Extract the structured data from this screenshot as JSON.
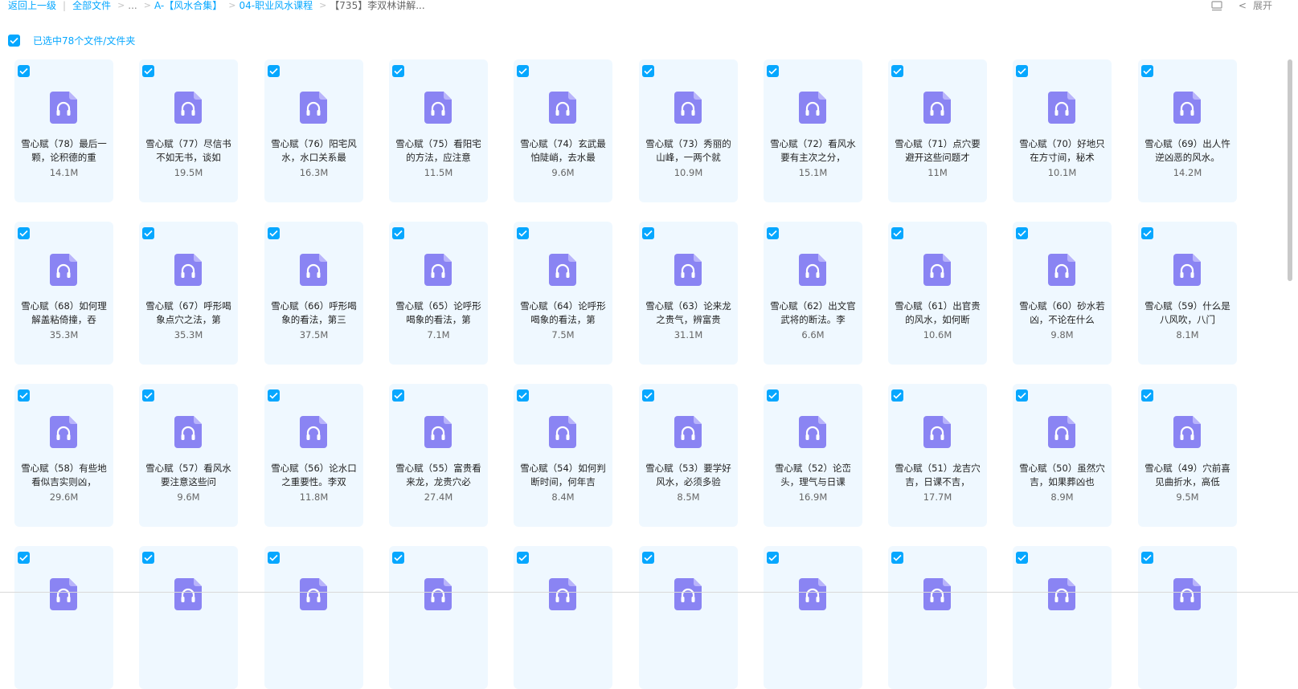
{
  "breadcrumb": {
    "back": "返回上一级",
    "all_files": "全部文件",
    "ellipsis": "...",
    "items": [
      "A-【风水合集】",
      "04-职业风水课程"
    ],
    "current": "【735】李双林讲解..."
  },
  "toolbar": {
    "expand_label": "展开",
    "view_icon": "list-view-icon"
  },
  "selection": {
    "label": "已选中78个文件/文件夹"
  },
  "colors": {
    "accent": "#06a7ff",
    "card_bg": "#eff8ff",
    "icon": "#8a84f3"
  },
  "files": [
    {
      "name": "雪心赋（78）最后一颗，论积德的重",
      "size": "14.1M"
    },
    {
      "name": "雪心赋（77）尽信书不如无书，谈如",
      "size": "19.5M"
    },
    {
      "name": "雪心赋（76）阳宅风水，水口关系最",
      "size": "16.3M"
    },
    {
      "name": "雪心赋（75）看阳宅的方法，应注意",
      "size": "11.5M"
    },
    {
      "name": "雪心赋（74）玄武最怕陡峭，去水最",
      "size": "9.6M"
    },
    {
      "name": "雪心赋（73）秀丽的山峰，一两个就",
      "size": "10.9M"
    },
    {
      "name": "雪心赋（72）看风水要有主次之分，",
      "size": "15.1M"
    },
    {
      "name": "雪心赋（71）点穴要避开这些问题才",
      "size": "11M"
    },
    {
      "name": "雪心赋（70）好地只在方寸间，秘术",
      "size": "10.1M"
    },
    {
      "name": "雪心赋（69）出人忤逆凶恶的风水。",
      "size": "14.2M"
    },
    {
      "name": "雪心赋（68）如何理解盖粘倚撞，吞",
      "size": "35.3M"
    },
    {
      "name": "雪心赋（67）呼形喝象点穴之法，第",
      "size": "35.3M"
    },
    {
      "name": "雪心赋（66）呼形喝象的看法，第三",
      "size": "37.5M"
    },
    {
      "name": "雪心赋（65）论呼形喝象的看法，第",
      "size": "7.1M"
    },
    {
      "name": "雪心赋（64）论呼形喝象的看法，第",
      "size": "7.5M"
    },
    {
      "name": "雪心赋（63）论来龙之贵气，辨富贵",
      "size": "31.1M"
    },
    {
      "name": "雪心赋（62）出文官武将的断法。李",
      "size": "6.6M"
    },
    {
      "name": "雪心赋（61）出官贵的风水，如何断",
      "size": "10.6M"
    },
    {
      "name": "雪心赋（60）砂水若凶，不论在什么",
      "size": "9.8M"
    },
    {
      "name": "雪心赋（59）什么是八风吹，八门",
      "size": "8.1M"
    },
    {
      "name": "雪心赋（58）有些地看似吉实则凶，",
      "size": "29.6M"
    },
    {
      "name": "雪心赋（57）看风水要注意这些问",
      "size": "9.6M"
    },
    {
      "name": "雪心赋（56）论水口之重要性。李双",
      "size": "11.8M"
    },
    {
      "name": "雪心赋（55）富贵看来龙，龙贵穴必",
      "size": "27.4M"
    },
    {
      "name": "雪心赋（54）如何判断时间，何年吉",
      "size": "8.4M"
    },
    {
      "name": "雪心赋（53）要学好风水，必须多验",
      "size": "8.5M"
    },
    {
      "name": "雪心赋（52）论峦头，理气与日课",
      "size": "16.9M"
    },
    {
      "name": "雪心赋（51）龙吉穴吉，日课不吉，",
      "size": "17.7M"
    },
    {
      "name": "雪心赋（50）虽然穴吉，如果葬凶也",
      "size": "8.9M"
    },
    {
      "name": "雪心赋（49）穴前喜见曲折水，高低",
      "size": "9.5M"
    },
    {
      "name": "",
      "size": ""
    },
    {
      "name": "",
      "size": ""
    },
    {
      "name": "",
      "size": ""
    },
    {
      "name": "",
      "size": ""
    },
    {
      "name": "",
      "size": ""
    },
    {
      "name": "",
      "size": ""
    },
    {
      "name": "",
      "size": ""
    },
    {
      "name": "",
      "size": ""
    },
    {
      "name": "",
      "size": ""
    },
    {
      "name": "",
      "size": ""
    }
  ]
}
